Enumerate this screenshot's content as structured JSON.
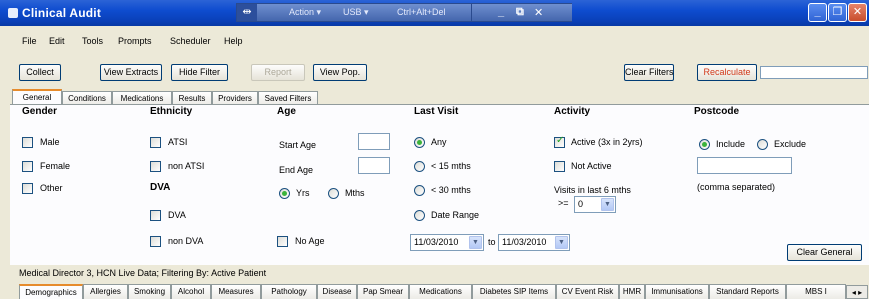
{
  "window": {
    "title": "Clinical Audit",
    "remote_bar": {
      "pin": "⇹",
      "items": [
        "Action ▾",
        "USB ▾",
        "Ctrl+Alt+Del"
      ],
      "controls": [
        "_",
        "⧉",
        "✕"
      ]
    },
    "buttons": {
      "minimize": "_",
      "maximize": "❐",
      "close": "✕"
    }
  },
  "menu": [
    "File",
    "Edit",
    "Tools",
    "Prompts",
    "Scheduler",
    "Help"
  ],
  "toolbar": {
    "collect": "Collect",
    "view_extracts": "View Extracts",
    "hide_filter": "Hide Filter",
    "report": "Report",
    "view_pop": "View Pop.",
    "clear_filters": "Clear Filters",
    "recalculate": "Recalculate"
  },
  "tabs": [
    "General",
    "Conditions",
    "Medications",
    "Results",
    "Providers",
    "Saved Filters"
  ],
  "active_tab": "General",
  "gender": {
    "heading": "Gender",
    "options": [
      "Male",
      "Female",
      "Other"
    ]
  },
  "ethnicity": {
    "heading": "Ethnicity",
    "options": [
      "ATSI",
      "non ATSI"
    ]
  },
  "dva": {
    "heading": "DVA",
    "options": [
      "DVA",
      "non DVA"
    ]
  },
  "age": {
    "heading": "Age",
    "start_label": "Start Age",
    "end_label": "End Age",
    "start_value": "",
    "end_value": "",
    "unit_yrs": "Yrs",
    "unit_mths": "Mths",
    "unit_selected": "Yrs",
    "no_age": "No Age"
  },
  "last_visit": {
    "heading": "Last Visit",
    "options": [
      "Any",
      "< 15 mths",
      "< 30 mths",
      "Date Range"
    ],
    "selected": "Any",
    "from_date": "11/03/2010",
    "to_label": "to",
    "to_date": "11/03/2010"
  },
  "activity": {
    "heading": "Activity",
    "active_label": "Active (3x in 2yrs)",
    "active_checked": true,
    "not_active_label": "Not Active",
    "visits_label": "Visits in last 6 mths",
    "operator": ">=",
    "visits_value": "0"
  },
  "postcode": {
    "heading": "Postcode",
    "include": "Include",
    "exclude": "Exclude",
    "selected": "Include",
    "value": "",
    "hint": "(comma separated)"
  },
  "clear_general": "Clear General",
  "status_text": "Medical Director 3, HCN Live Data; Filtering By: Active Patient",
  "bottom_tabs": [
    "Demographics",
    "Allergies",
    "Smoking",
    "Alcohol",
    "Measures",
    "Pathology",
    "Disease",
    "Pap Smear",
    "Medications",
    "Diabetes SIP Items",
    "CV Event Risk",
    "HMR",
    "Immunisations",
    "Standard Reports",
    "MBS I"
  ],
  "bottom_active": "Demographics",
  "tab_scroll": "◂ ▸"
}
